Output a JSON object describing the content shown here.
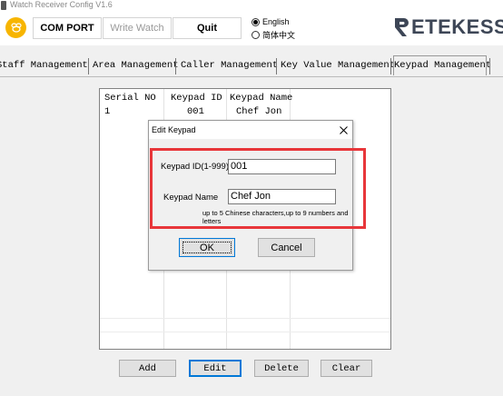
{
  "window": {
    "title": "Watch Receiver Config V1.6"
  },
  "toolbar": {
    "com_port": "COM PORT",
    "write_watch": "Write Watch",
    "quit": "Quit",
    "language_options": [
      {
        "label": "English",
        "selected": true
      },
      {
        "label": "简体中文",
        "selected": false
      }
    ],
    "brand": "ETEKESS",
    "brand_color": "#3d4656",
    "logo_color": "#f7b500"
  },
  "tabs": [
    {
      "label": "Staff Management",
      "active": false
    },
    {
      "label": "Area Management",
      "active": false
    },
    {
      "label": "Caller Management",
      "active": false
    },
    {
      "label": "Key Value Management",
      "active": false
    },
    {
      "label": "Keypad Management",
      "active": true
    }
  ],
  "list": {
    "columns": [
      "Serial NO",
      "Keypad ID",
      "Keypad Name"
    ],
    "rows": [
      [
        "1",
        "001",
        "Chef Jon"
      ]
    ]
  },
  "buttons": {
    "add": "Add",
    "edit": "Edit",
    "delete": "Delete",
    "clear": "Clear"
  },
  "dialog": {
    "title": "Edit Keypad",
    "keypad_id_label": "Keypad ID(1-999)",
    "keypad_id_value": "001",
    "keypad_name_label": "Keypad Name",
    "keypad_name_value": "Chef Jon",
    "hint": "up to 5 Chinese characters,up to 9 numbers and letters",
    "ok": "OK",
    "cancel": "Cancel"
  },
  "highlight_color": "#e8363a"
}
